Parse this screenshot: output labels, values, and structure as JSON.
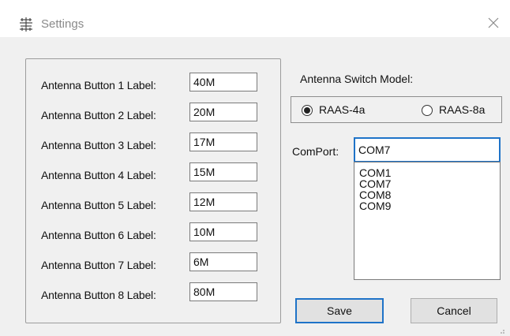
{
  "window": {
    "title": "Settings",
    "icon": "settings-app-icon"
  },
  "labels": {
    "rows": [
      {
        "label": "Antenna Button 1 Label:",
        "value": "40M"
      },
      {
        "label": "Antenna Button 2 Label:",
        "value": "20M"
      },
      {
        "label": "Antenna Button 3 Label:",
        "value": "17M"
      },
      {
        "label": "Antenna Button 4 Label:",
        "value": "15M"
      },
      {
        "label": "Antenna Button 5 Label:",
        "value": "12M"
      },
      {
        "label": "Antenna Button 6 Label:",
        "value": "10M"
      },
      {
        "label": "Antenna Button 7 Label:",
        "value": "6M"
      },
      {
        "label": "Antenna Button 8 Label:",
        "value": "80M"
      }
    ]
  },
  "switch_model": {
    "label": "Antenna Switch Model:",
    "options": [
      {
        "label": "RAAS-4a",
        "selected": true
      },
      {
        "label": "RAAS-8a",
        "selected": false
      }
    ]
  },
  "comport": {
    "label": "ComPort:",
    "value": "COM7",
    "options": [
      "COM1",
      "COM7",
      "COM8",
      "COM9"
    ]
  },
  "buttons": {
    "save": "Save",
    "cancel": "Cancel"
  },
  "colors": {
    "focus_border": "#1f73c8",
    "window_bg": "#f0f0f0"
  }
}
